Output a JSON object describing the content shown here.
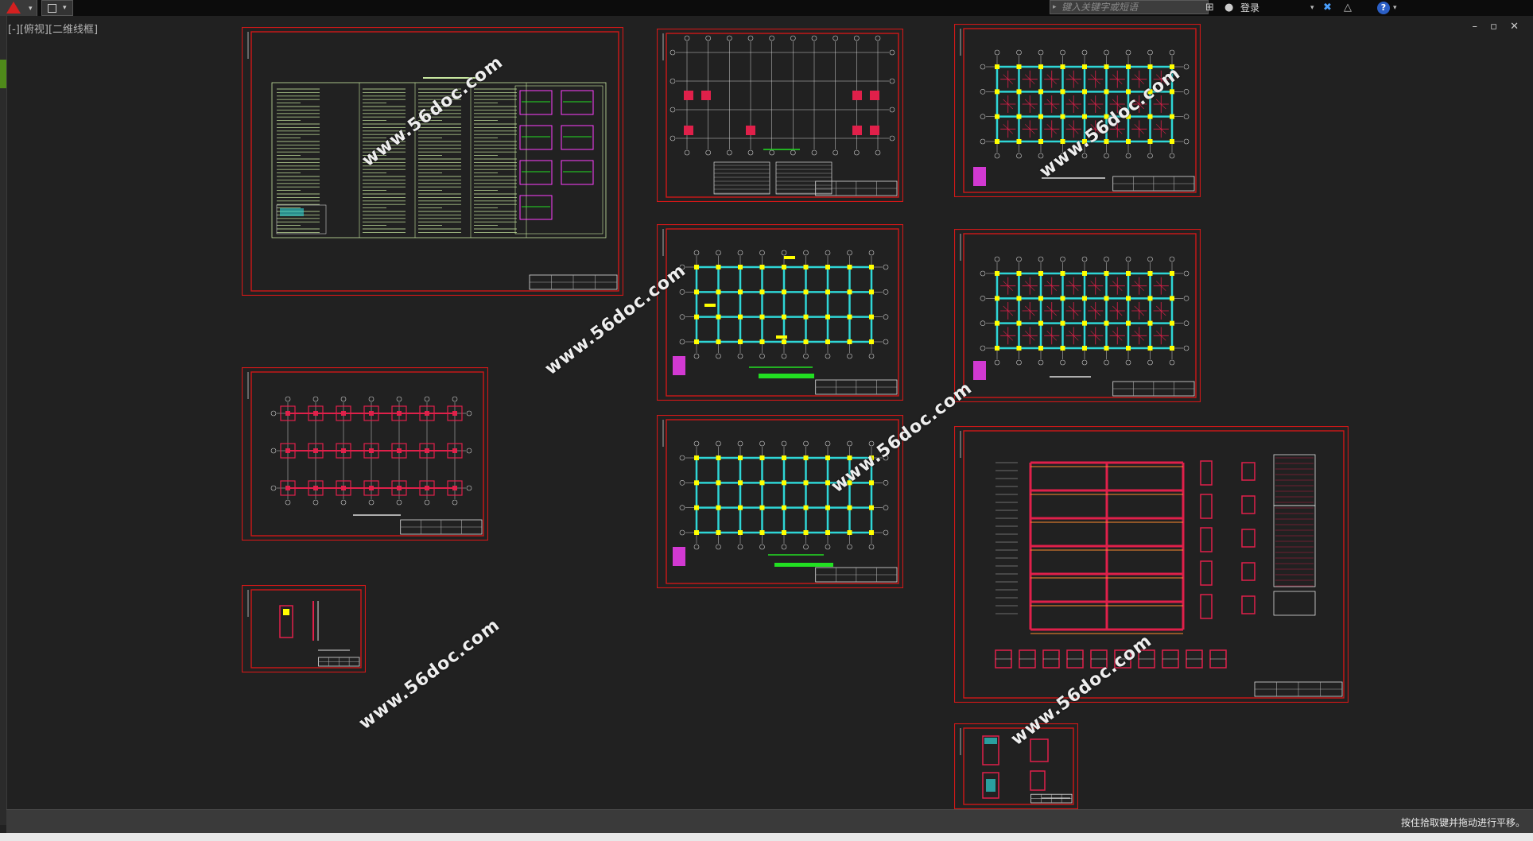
{
  "app": {
    "name": "AutoCAD",
    "menu_icon": "autocad-logo-icon"
  },
  "quick_access": {
    "icon": "save-icon"
  },
  "toolbar": {
    "search_placeholder": "键入关键字或短语",
    "login_label": "登录",
    "icons": [
      "binoculars-icon",
      "user-icon",
      "exchange-x-icon",
      "a360-icon",
      "help-icon"
    ]
  },
  "viewport": {
    "label": "[-][俯视][二维线框]",
    "window_controls": "– ▫ ✕"
  },
  "status": {
    "text": "按住拾取键并拖动进行平移。"
  },
  "watermark": {
    "text": "www.56doc.com"
  },
  "colors": {
    "background": "#212121",
    "frame": "#d01818",
    "grid": "#cfcfcf",
    "beam": "#2fd6d6",
    "rebar": "#e0204a",
    "note_text": "#c8e8a0",
    "green_title": "#22e022",
    "yellow": "#ffff00"
  }
}
